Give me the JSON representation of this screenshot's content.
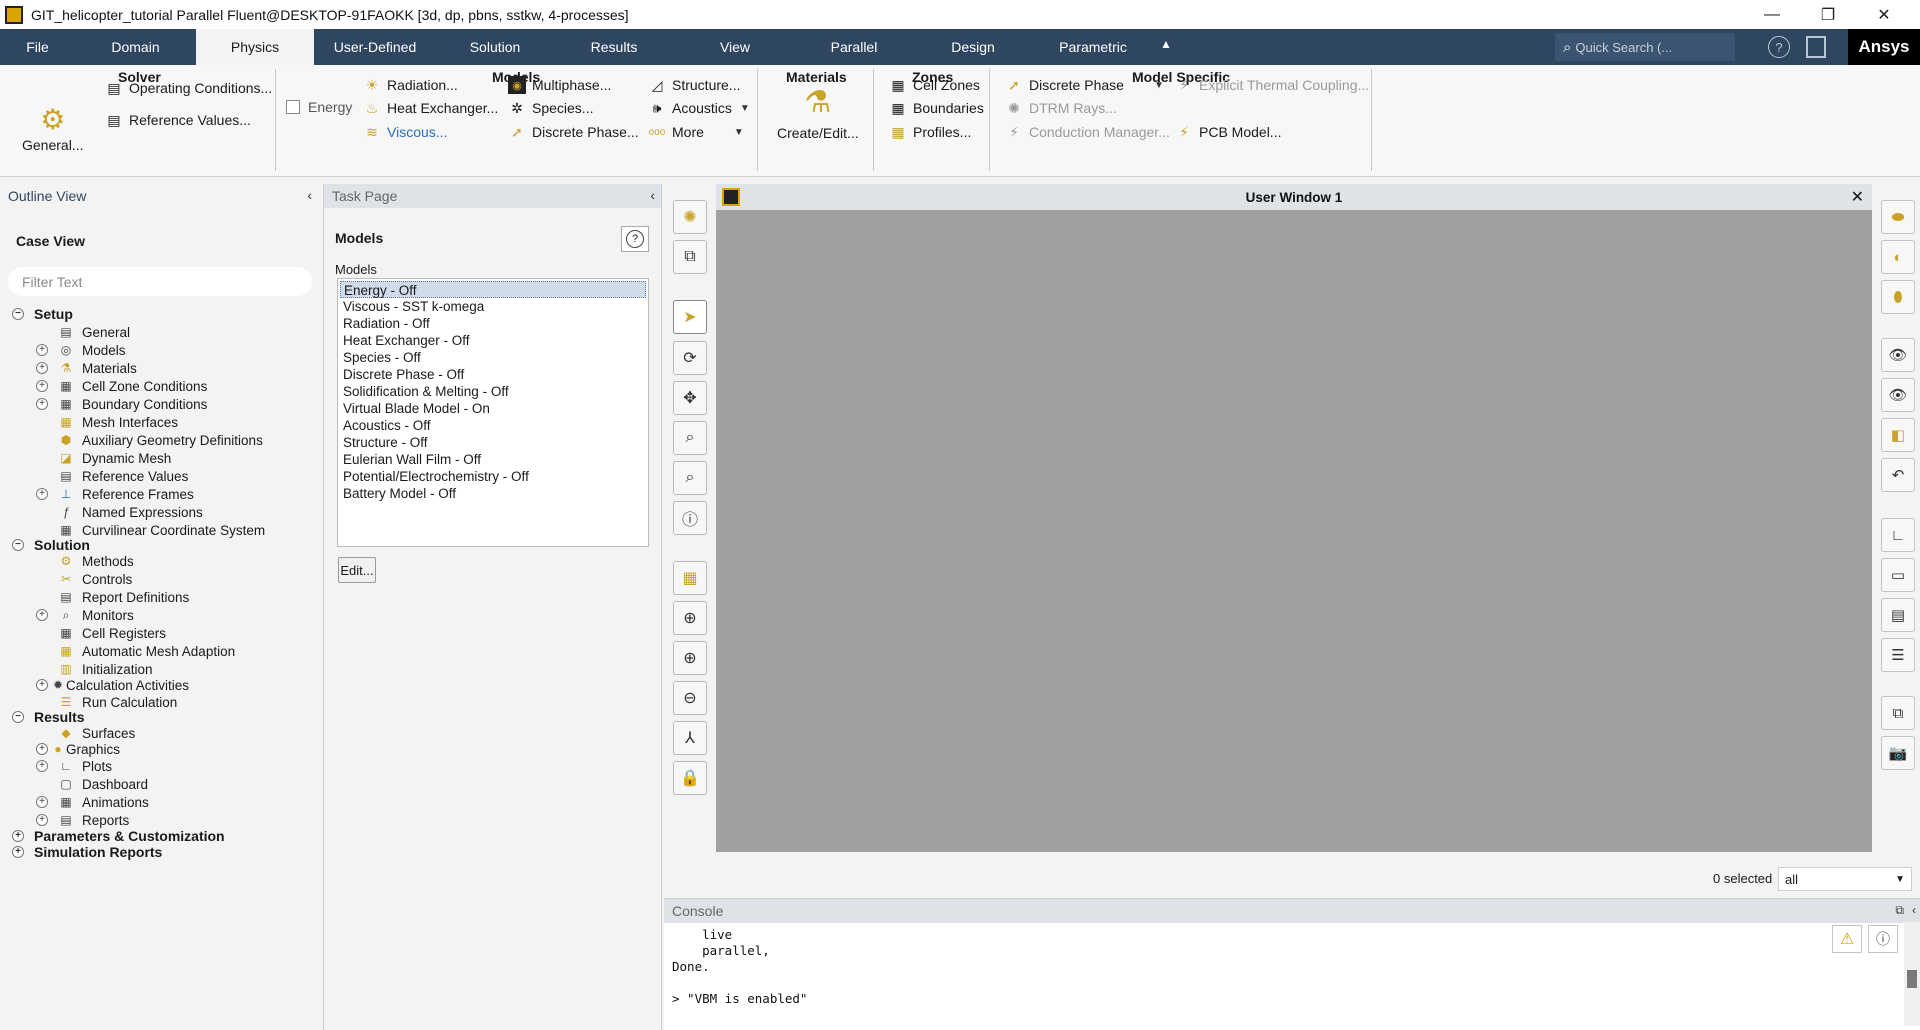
{
  "window": {
    "title": "GIT_helicopter_tutorial Parallel Fluent@DESKTOP-91FAOKK  [3d, dp, pbns, sstkw, 4-processes]",
    "minimize": "—",
    "restore": "❐",
    "close": "✕"
  },
  "menubar": {
    "tabs": [
      "File",
      "Domain",
      "Physics",
      "User-Defined",
      "Solution",
      "Results",
      "View",
      "Parallel",
      "Design",
      "Parametric"
    ],
    "active_tab": "Physics",
    "collapse_icon": "▲",
    "search_placeholder": "Quick Search (...",
    "help": "?",
    "logo": "Ansys"
  },
  "ribbon": {
    "solver": {
      "title": "Solver",
      "general": "General...",
      "operating_conditions": "Operating Conditions...",
      "reference_values": "Reference Values..."
    },
    "models": {
      "title": "Models",
      "energy": "Energy",
      "radiation": "Radiation...",
      "heat_exchanger": "Heat Exchanger...",
      "viscous": "Viscous...",
      "multiphase": "Multiphase...",
      "species": "Species...",
      "discrete_phase": "Discrete Phase...",
      "structure": "Structure...",
      "acoustics": "Acoustics",
      "more": "More"
    },
    "materials": {
      "title": "Materials",
      "create_edit": "Create/Edit..."
    },
    "zones": {
      "title": "Zones",
      "cell_zones": "Cell Zones",
      "boundaries": "Boundaries",
      "profiles": "Profiles..."
    },
    "model_specific": {
      "title": "Model Specific",
      "discrete_phase": "Discrete Phase",
      "dtrm_rays": "DTRM Rays...",
      "conduction_manager": "Conduction Manager...",
      "explicit_thermal_coupling": "Explicit Thermal Coupling...",
      "pcb_model": "PCB Model..."
    }
  },
  "outline": {
    "header": "Outline View",
    "case_view": "Case View",
    "filter_placeholder": "Filter Text",
    "setup": {
      "label": "Setup",
      "items": [
        "General",
        "Models",
        "Materials",
        "Cell Zone Conditions",
        "Boundary Conditions",
        "Mesh Interfaces",
        "Auxiliary Geometry Definitions",
        "Dynamic Mesh",
        "Reference Values",
        "Reference Frames",
        "Named Expressions",
        "Curvilinear Coordinate System"
      ]
    },
    "solution": {
      "label": "Solution",
      "items": [
        "Methods",
        "Controls",
        "Report Definitions",
        "Monitors",
        "Cell Registers",
        "Automatic Mesh Adaption",
        "Initialization",
        "Calculation Activities",
        "Run Calculation"
      ]
    },
    "results": {
      "label": "Results",
      "items": [
        "Surfaces",
        "Graphics",
        "Plots",
        "Dashboard",
        "Animations",
        "Reports"
      ]
    },
    "parameters": "Parameters & Customization",
    "simulation_reports": "Simulation Reports"
  },
  "task_page": {
    "header": "Task Page",
    "title": "Models",
    "list_label": "Models",
    "models": [
      "Energy - Off",
      "Viscous - SST k-omega",
      "Radiation - Off",
      "Heat Exchanger - Off",
      "Species - Off",
      "Discrete Phase - Off",
      "Solidification & Melting - Off",
      "Virtual Blade Model - On",
      "Acoustics - Off",
      "Structure - Off",
      "Eulerian Wall Film - Off",
      "Potential/Electrochemistry - Off",
      "Battery Model - Off"
    ],
    "selected_model": "Energy - Off",
    "edit_button": "Edit..."
  },
  "user_window": {
    "title": "User Window 1",
    "close": "✕"
  },
  "selection": {
    "count_label": "0 selected",
    "filter_value": "all"
  },
  "console": {
    "header": "Console",
    "lines": "    live\n    parallel,\nDone.\n\n> \"VBM is enabled\""
  }
}
